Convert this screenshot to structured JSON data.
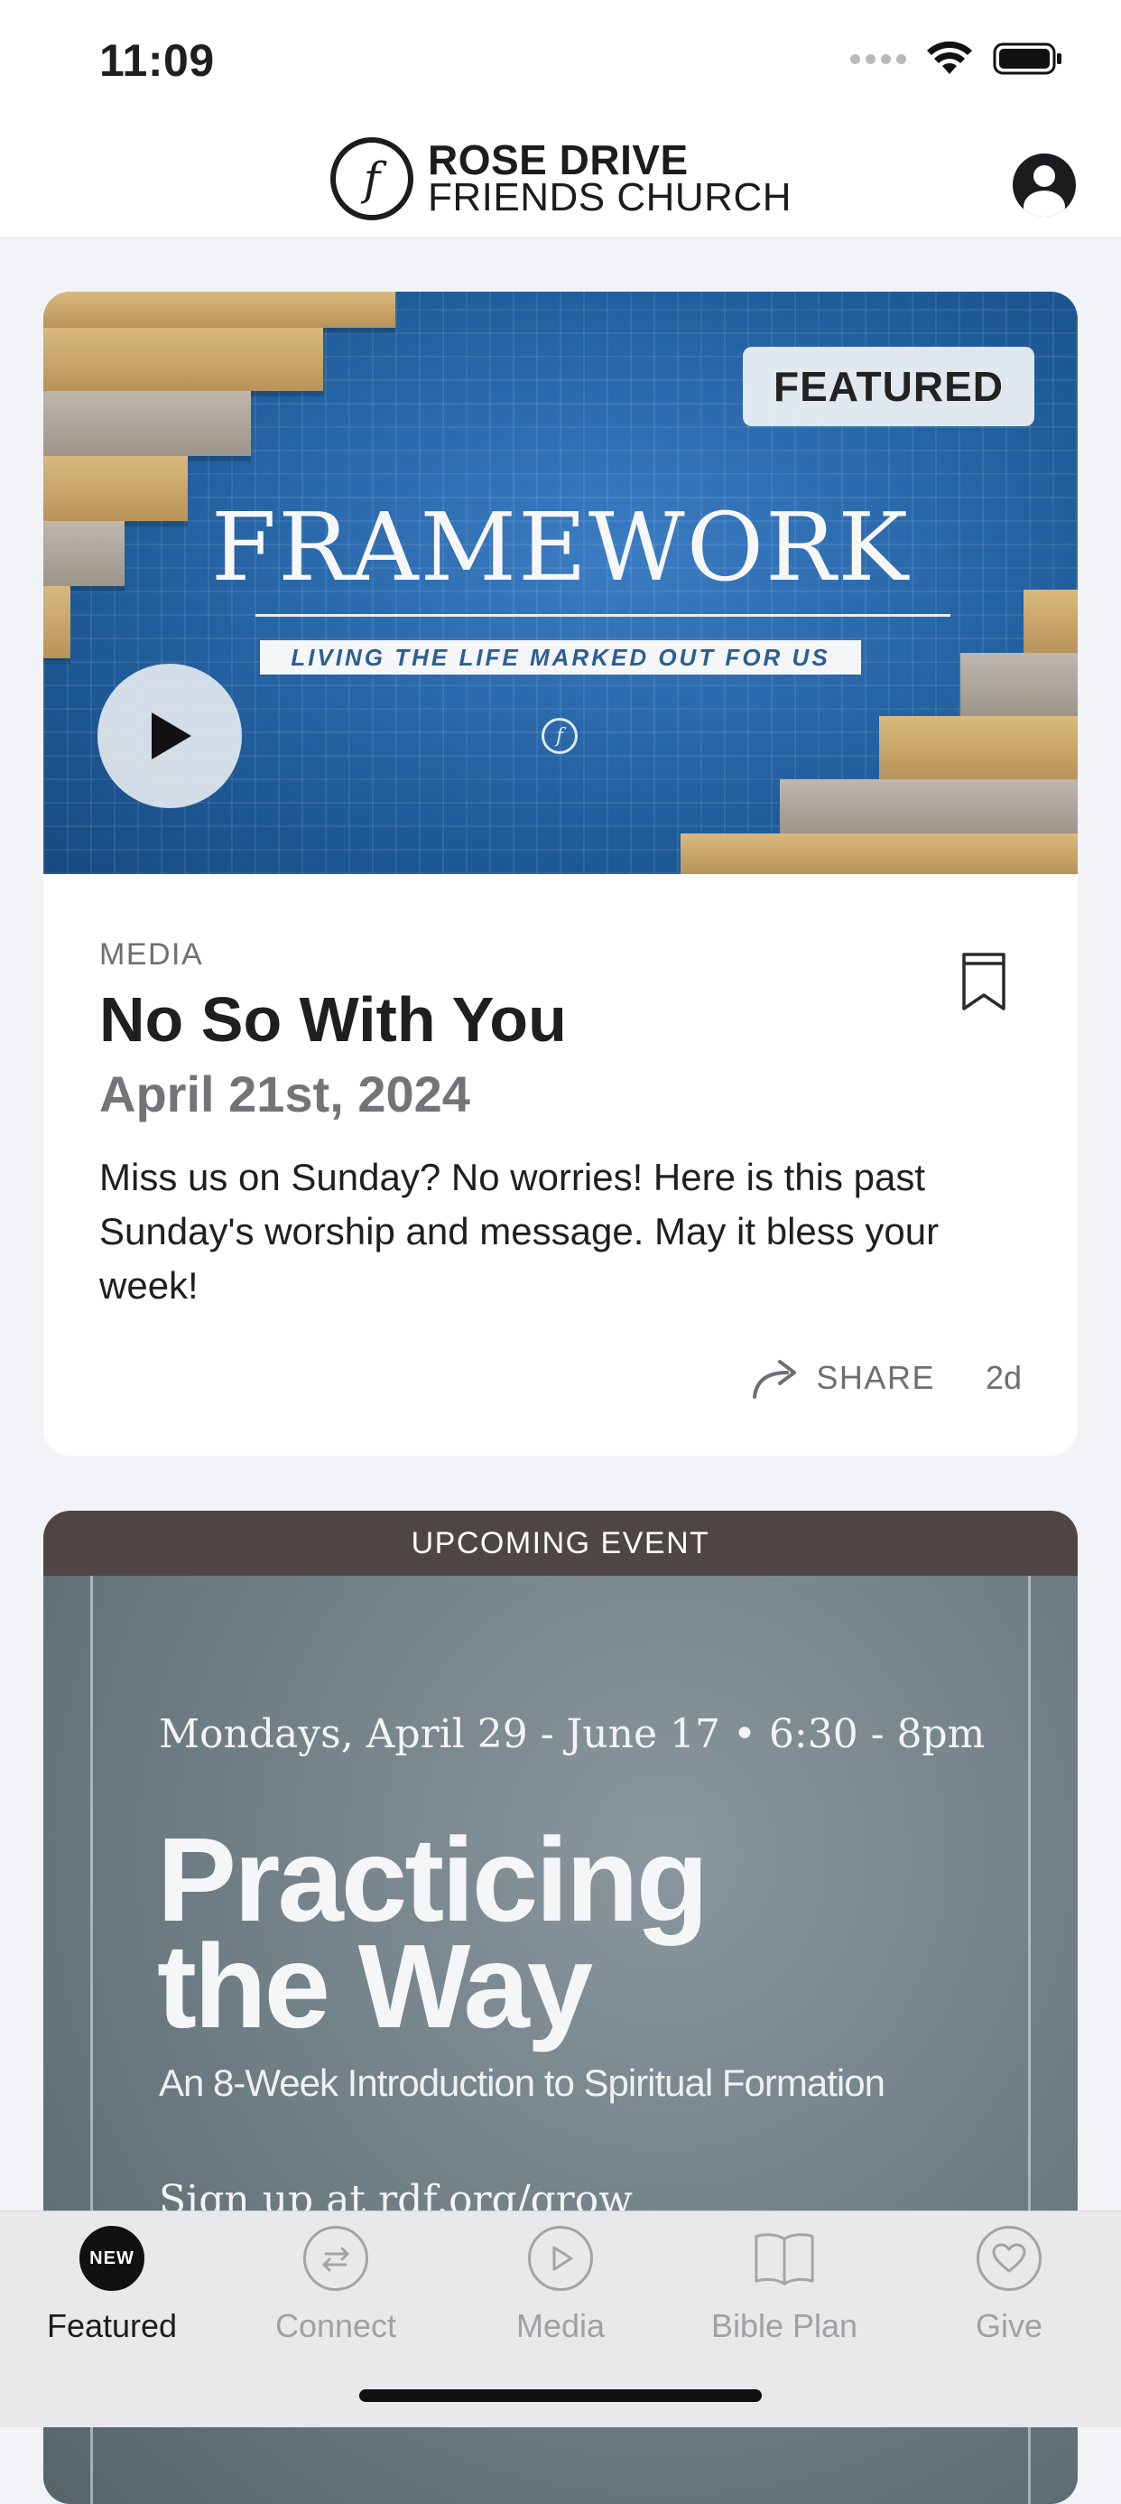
{
  "status": {
    "time": "11:09"
  },
  "header": {
    "logo_line1": "ROSE DRIVE",
    "logo_line2": "FRIENDS CHURCH",
    "logo_mark": "f"
  },
  "featured": {
    "badge": "FEATURED",
    "hero_title": "FRAMEWORK",
    "hero_subtitle": "LIVING THE LIFE MARKED OUT FOR US",
    "category": "MEDIA",
    "title": "No So With You",
    "date": "April 21st, 2024",
    "description": "Miss us on Sunday? No worries! Here is this past Sunday's worship and message. May it bless your week!",
    "share_label": "SHARE",
    "age": "2d",
    "accent": "#22609f"
  },
  "event": {
    "header": "UPCOMING EVENT",
    "when": "Mondays, April 29 - June 17 • 6:30 - 8pm",
    "title_line1": "Practicing",
    "title_line2": "the Way",
    "subtitle": "An 8-Week Introduction to Spiritual Formation",
    "signup": "Sign up at rdf.org/grow"
  },
  "tabs": [
    {
      "label": "Featured",
      "icon": "new-badge-icon",
      "badge": "NEW",
      "active": true
    },
    {
      "label": "Connect",
      "icon": "connect-arrows-icon",
      "active": false
    },
    {
      "label": "Media",
      "icon": "play-circle-icon",
      "active": false
    },
    {
      "label": "Bible Plan",
      "icon": "book-icon",
      "active": false
    },
    {
      "label": "Give",
      "icon": "heart-icon",
      "active": false
    }
  ]
}
